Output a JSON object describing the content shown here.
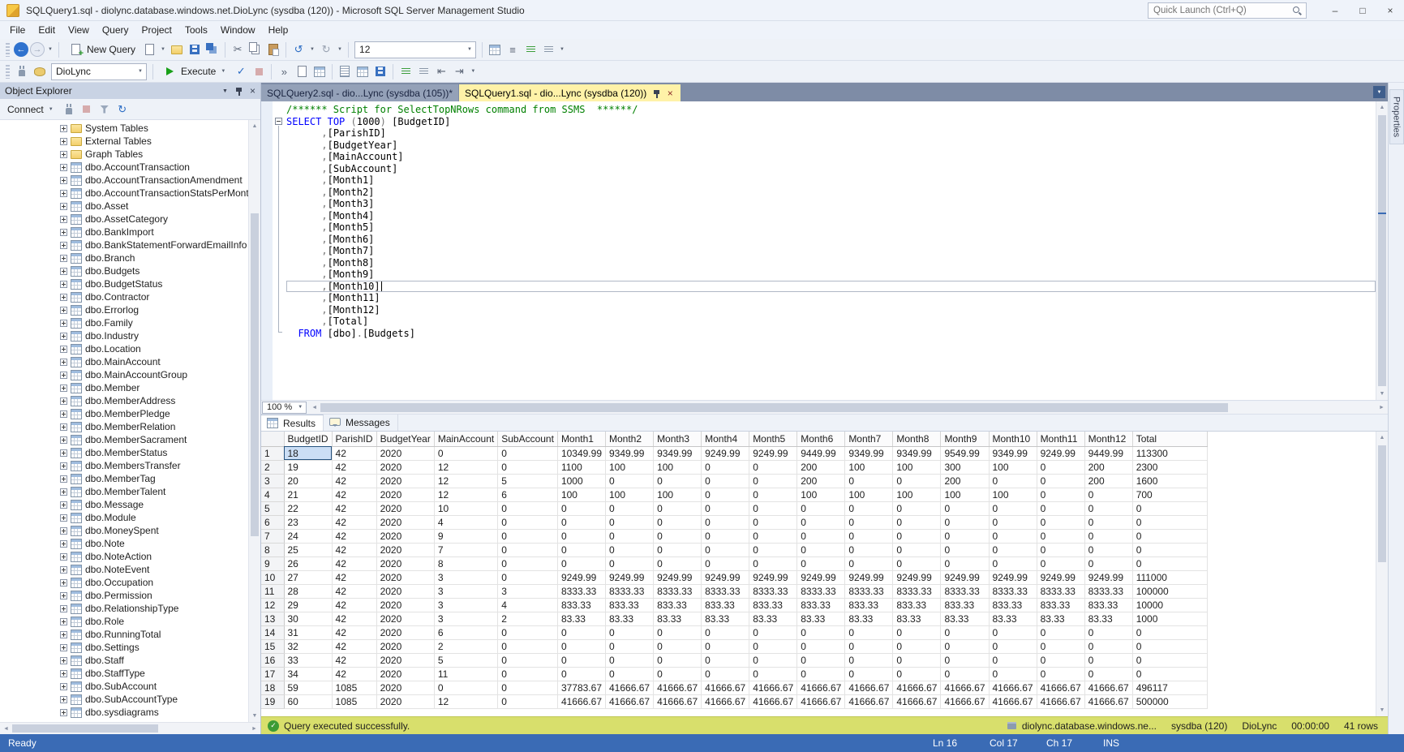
{
  "title_bar": {
    "title": "SQLQuery1.sql - diolync.database.windows.net.DioLync (sysdba (120)) - Microsoft SQL Server Management Studio",
    "quick_launch": "Quick Launch (Ctrl+Q)"
  },
  "menu": {
    "items": [
      "File",
      "Edit",
      "View",
      "Query",
      "Project",
      "Tools",
      "Window",
      "Help"
    ]
  },
  "toolbar_main": {
    "items": [
      {
        "kind": "grip"
      },
      {
        "kind": "navback",
        "name": "nav-back-icon",
        "glyph": "←"
      },
      {
        "kind": "navfwd",
        "name": "nav-forward-icon",
        "glyph": "→"
      },
      {
        "kind": "dd",
        "name": "nav-history-dropdown-icon",
        "glyph": "▼"
      },
      {
        "kind": "sep"
      },
      {
        "kind": "btn",
        "name": "new-query-button",
        "icon": "docplus",
        "label": "New Query"
      },
      {
        "kind": "doc",
        "name": "new-file-icon"
      },
      {
        "kind": "dd",
        "name": "new-file-dropdown-icon",
        "glyph": "▼"
      },
      {
        "kind": "folder",
        "name": "open-file-icon"
      },
      {
        "kind": "save",
        "name": "save-icon"
      },
      {
        "kind": "saveall",
        "name": "save-all-icon"
      },
      {
        "kind": "sep"
      },
      {
        "kind": "glyph",
        "name": "cut-icon",
        "glyph": "✂",
        "color": "#5A6475"
      },
      {
        "kind": "copy",
        "name": "copy-icon"
      },
      {
        "kind": "paste",
        "name": "paste-icon"
      },
      {
        "kind": "sep"
      },
      {
        "kind": "glyph",
        "name": "undo-icon",
        "glyph": "↺",
        "color": "#2B6CC4"
      },
      {
        "kind": "dd",
        "name": "undo-dropdown-icon",
        "glyph": "▼"
      },
      {
        "kind": "glyph",
        "name": "redo-icon",
        "glyph": "↻",
        "color": "#9AA3B2"
      },
      {
        "kind": "dd",
        "name": "redo-dropdown-icon",
        "glyph": "▼"
      },
      {
        "kind": "sep"
      },
      {
        "kind": "combo",
        "name": "font-size-combo",
        "value": "12",
        "width": 150
      },
      {
        "kind": "sep"
      },
      {
        "kind": "table",
        "name": "table-designer-icon"
      },
      {
        "kind": "glyph",
        "name": "properties-window-icon",
        "glyph": "≡",
        "color": "#5A6475"
      },
      {
        "kind": "comment",
        "name": "comment-icon"
      },
      {
        "kind": "comment2",
        "name": "uncomment-icon"
      },
      {
        "kind": "dd",
        "name": "toolbar-options-icon",
        "glyph": "▼"
      }
    ]
  },
  "toolbar_query": {
    "items": [
      {
        "kind": "grip"
      },
      {
        "kind": "plug",
        "name": "change-connection-icon"
      },
      {
        "kind": "db",
        "name": "available-databases-icon"
      },
      {
        "kind": "combo",
        "name": "database-combo",
        "value": "DioLync",
        "width": 118
      },
      {
        "kind": "sep"
      },
      {
        "kind": "btn",
        "name": "execute-button",
        "icon": "play",
        "label": "Execute",
        "dd": true
      },
      {
        "kind": "glyph",
        "name": "parse-icon",
        "glyph": "✓",
        "color": "#2B6CC4"
      },
      {
        "kind": "stop",
        "name": "cancel-query-icon",
        "disabled": true
      },
      {
        "kind": "sep"
      },
      {
        "kind": "glyph",
        "name": "sqlcmd-icon",
        "glyph": "»",
        "color": "#5A6475"
      },
      {
        "kind": "doc",
        "name": "display-estimated-plan-icon"
      },
      {
        "kind": "table",
        "name": "include-actual-plan-icon"
      },
      {
        "kind": "sep"
      },
      {
        "kind": "txt",
        "name": "results-to-text-icon"
      },
      {
        "kind": "grid3",
        "name": "results-to-grid-icon"
      },
      {
        "kind": "save",
        "name": "results-to-file-icon"
      },
      {
        "kind": "sep"
      },
      {
        "kind": "comment",
        "name": "comment-icon"
      },
      {
        "kind": "comment2",
        "name": "uncomment-icon"
      },
      {
        "kind": "glyph",
        "name": "decrease-indent-icon",
        "glyph": "⇤",
        "color": "#5A6475"
      },
      {
        "kind": "glyph",
        "name": "increase-indent-icon",
        "glyph": "⇥",
        "color": "#5A6475"
      },
      {
        "kind": "dd",
        "name": "toolbar-options-icon",
        "glyph": "▼"
      }
    ]
  },
  "object_explorer": {
    "title": "Object Explorer",
    "toolbar": [
      {
        "kind": "btn",
        "name": "connect-button",
        "label": "Connect",
        "dd": true
      },
      {
        "kind": "plug",
        "name": "disconnect-icon"
      },
      {
        "kind": "stop",
        "name": "stop-icon",
        "disabled": true
      },
      {
        "kind": "filter",
        "name": "filter-icon"
      },
      {
        "kind": "glyph",
        "name": "refresh-icon",
        "glyph": "↻",
        "color": "#2B6CC4"
      }
    ],
    "items": [
      {
        "type": "folder",
        "label": "System Tables"
      },
      {
        "type": "folder",
        "label": "External Tables"
      },
      {
        "type": "folder",
        "label": "Graph Tables"
      },
      {
        "type": "table",
        "label": "dbo.AccountTransaction"
      },
      {
        "type": "table",
        "label": "dbo.AccountTransactionAmendment"
      },
      {
        "type": "table",
        "label": "dbo.AccountTransactionStatsPerMonth"
      },
      {
        "type": "table",
        "label": "dbo.Asset"
      },
      {
        "type": "table",
        "label": "dbo.AssetCategory"
      },
      {
        "type": "table",
        "label": "dbo.BankImport"
      },
      {
        "type": "table",
        "label": "dbo.BankStatementForwardEmailInfo"
      },
      {
        "type": "table",
        "label": "dbo.Branch"
      },
      {
        "type": "table",
        "label": "dbo.Budgets"
      },
      {
        "type": "table",
        "label": "dbo.BudgetStatus"
      },
      {
        "type": "table",
        "label": "dbo.Contractor"
      },
      {
        "type": "table",
        "label": "dbo.Errorlog"
      },
      {
        "type": "table",
        "label": "dbo.Family"
      },
      {
        "type": "table",
        "label": "dbo.Industry"
      },
      {
        "type": "table",
        "label": "dbo.Location"
      },
      {
        "type": "table",
        "label": "dbo.MainAccount"
      },
      {
        "type": "table",
        "label": "dbo.MainAccountGroup"
      },
      {
        "type": "table",
        "label": "dbo.Member"
      },
      {
        "type": "table",
        "label": "dbo.MemberAddress"
      },
      {
        "type": "table",
        "label": "dbo.MemberPledge"
      },
      {
        "type": "table",
        "label": "dbo.MemberRelation"
      },
      {
        "type": "table",
        "label": "dbo.MemberSacrament"
      },
      {
        "type": "table",
        "label": "dbo.MemberStatus"
      },
      {
        "type": "table",
        "label": "dbo.MembersTransfer"
      },
      {
        "type": "table",
        "label": "dbo.MemberTag"
      },
      {
        "type": "table",
        "label": "dbo.MemberTalent"
      },
      {
        "type": "table",
        "label": "dbo.Message"
      },
      {
        "type": "table",
        "label": "dbo.Module"
      },
      {
        "type": "table",
        "label": "dbo.MoneySpent"
      },
      {
        "type": "table",
        "label": "dbo.Note"
      },
      {
        "type": "table",
        "label": "dbo.NoteAction"
      },
      {
        "type": "table",
        "label": "dbo.NoteEvent"
      },
      {
        "type": "table",
        "label": "dbo.Occupation"
      },
      {
        "type": "table",
        "label": "dbo.Permission"
      },
      {
        "type": "table",
        "label": "dbo.RelationshipType"
      },
      {
        "type": "table",
        "label": "dbo.Role"
      },
      {
        "type": "table",
        "label": "dbo.RunningTotal"
      },
      {
        "type": "table",
        "label": "dbo.Settings"
      },
      {
        "type": "table",
        "label": "dbo.Staff"
      },
      {
        "type": "table",
        "label": "dbo.StaffType"
      },
      {
        "type": "table",
        "label": "dbo.SubAccount"
      },
      {
        "type": "table",
        "label": "dbo.SubAccountType"
      },
      {
        "type": "table",
        "label": "dbo.sysdiagrams"
      }
    ]
  },
  "editor": {
    "tabs": [
      {
        "label": "SQLQuery2.sql - dio...Lync (sysdba (105))*"
      },
      {
        "label": "SQLQuery1.sql - dio...Lync (sysdba (120))"
      }
    ],
    "zoom": "100 %",
    "active_line": 15,
    "code_lines": [
      [
        [
          "/****** Script for SelectTopNRows command from SSMS  ******/",
          "c"
        ]
      ],
      [
        [
          "SELECT",
          "k"
        ],
        [
          " ",
          "t"
        ],
        [
          "TOP",
          "k"
        ],
        [
          " ",
          "t"
        ],
        [
          "(",
          "o"
        ],
        [
          "1000",
          "n"
        ],
        [
          ")",
          "o"
        ],
        [
          " [BudgetID]",
          "t"
        ]
      ],
      [
        [
          "      ",
          "t"
        ],
        [
          ",",
          "o"
        ],
        [
          "[ParishID]",
          "t"
        ]
      ],
      [
        [
          "      ",
          "t"
        ],
        [
          ",",
          "o"
        ],
        [
          "[BudgetYear]",
          "t"
        ]
      ],
      [
        [
          "      ",
          "t"
        ],
        [
          ",",
          "o"
        ],
        [
          "[MainAccount]",
          "t"
        ]
      ],
      [
        [
          "      ",
          "t"
        ],
        [
          ",",
          "o"
        ],
        [
          "[SubAccount]",
          "t"
        ]
      ],
      [
        [
          "      ",
          "t"
        ],
        [
          ",",
          "o"
        ],
        [
          "[Month1]",
          "t"
        ]
      ],
      [
        [
          "      ",
          "t"
        ],
        [
          ",",
          "o"
        ],
        [
          "[Month2]",
          "t"
        ]
      ],
      [
        [
          "      ",
          "t"
        ],
        [
          ",",
          "o"
        ],
        [
          "[Month3]",
          "t"
        ]
      ],
      [
        [
          "      ",
          "t"
        ],
        [
          ",",
          "o"
        ],
        [
          "[Month4]",
          "t"
        ]
      ],
      [
        [
          "      ",
          "t"
        ],
        [
          ",",
          "o"
        ],
        [
          "[Month5]",
          "t"
        ]
      ],
      [
        [
          "      ",
          "t"
        ],
        [
          ",",
          "o"
        ],
        [
          "[Month6]",
          "t"
        ]
      ],
      [
        [
          "      ",
          "t"
        ],
        [
          ",",
          "o"
        ],
        [
          "[Month7]",
          "t"
        ]
      ],
      [
        [
          "      ",
          "t"
        ],
        [
          ",",
          "o"
        ],
        [
          "[Month8]",
          "t"
        ]
      ],
      [
        [
          "      ",
          "t"
        ],
        [
          ",",
          "o"
        ],
        [
          "[Month9]",
          "t"
        ]
      ],
      [
        [
          "      ",
          "t"
        ],
        [
          ",",
          "o"
        ],
        [
          "[Month10]",
          "t"
        ]
      ],
      [
        [
          "      ",
          "t"
        ],
        [
          ",",
          "o"
        ],
        [
          "[Month11]",
          "t"
        ]
      ],
      [
        [
          "      ",
          "t"
        ],
        [
          ",",
          "o"
        ],
        [
          "[Month12]",
          "t"
        ]
      ],
      [
        [
          "      ",
          "t"
        ],
        [
          ",",
          "o"
        ],
        [
          "[Total]",
          "t"
        ]
      ],
      [
        [
          "  ",
          "t"
        ],
        [
          "FROM",
          "k"
        ],
        [
          " [dbo]",
          "t"
        ],
        [
          ".",
          "o"
        ],
        [
          "[Budgets]",
          "t"
        ]
      ]
    ]
  },
  "results": {
    "tabs": [
      "Results",
      "Messages"
    ],
    "columns": [
      "BudgetID",
      "ParishID",
      "BudgetYear",
      "MainAccount",
      "SubAccount",
      "Month1",
      "Month2",
      "Month3",
      "Month4",
      "Month5",
      "Month6",
      "Month7",
      "Month8",
      "Month9",
      "Month10",
      "Month11",
      "Month12",
      "Total"
    ],
    "selected_cell": {
      "row": 0,
      "col": 0
    },
    "rows": [
      [
        "18",
        "42",
        "2020",
        "0",
        "0",
        "10349.99",
        "9349.99",
        "9349.99",
        "9249.99",
        "9249.99",
        "9449.99",
        "9349.99",
        "9349.99",
        "9549.99",
        "9349.99",
        "9249.99",
        "9449.99",
        "113300"
      ],
      [
        "19",
        "42",
        "2020",
        "12",
        "0",
        "1100",
        "100",
        "100",
        "0",
        "0",
        "200",
        "100",
        "100",
        "300",
        "100",
        "0",
        "200",
        "2300"
      ],
      [
        "20",
        "42",
        "2020",
        "12",
        "5",
        "1000",
        "0",
        "0",
        "0",
        "0",
        "200",
        "0",
        "0",
        "200",
        "0",
        "0",
        "200",
        "1600"
      ],
      [
        "21",
        "42",
        "2020",
        "12",
        "6",
        "100",
        "100",
        "100",
        "0",
        "0",
        "100",
        "100",
        "100",
        "100",
        "100",
        "0",
        "0",
        "700"
      ],
      [
        "22",
        "42",
        "2020",
        "10",
        "0",
        "0",
        "0",
        "0",
        "0",
        "0",
        "0",
        "0",
        "0",
        "0",
        "0",
        "0",
        "0",
        "0"
      ],
      [
        "23",
        "42",
        "2020",
        "4",
        "0",
        "0",
        "0",
        "0",
        "0",
        "0",
        "0",
        "0",
        "0",
        "0",
        "0",
        "0",
        "0",
        "0"
      ],
      [
        "24",
        "42",
        "2020",
        "9",
        "0",
        "0",
        "0",
        "0",
        "0",
        "0",
        "0",
        "0",
        "0",
        "0",
        "0",
        "0",
        "0",
        "0"
      ],
      [
        "25",
        "42",
        "2020",
        "7",
        "0",
        "0",
        "0",
        "0",
        "0",
        "0",
        "0",
        "0",
        "0",
        "0",
        "0",
        "0",
        "0",
        "0"
      ],
      [
        "26",
        "42",
        "2020",
        "8",
        "0",
        "0",
        "0",
        "0",
        "0",
        "0",
        "0",
        "0",
        "0",
        "0",
        "0",
        "0",
        "0",
        "0"
      ],
      [
        "27",
        "42",
        "2020",
        "3",
        "0",
        "9249.99",
        "9249.99",
        "9249.99",
        "9249.99",
        "9249.99",
        "9249.99",
        "9249.99",
        "9249.99",
        "9249.99",
        "9249.99",
        "9249.99",
        "9249.99",
        "111000"
      ],
      [
        "28",
        "42",
        "2020",
        "3",
        "3",
        "8333.33",
        "8333.33",
        "8333.33",
        "8333.33",
        "8333.33",
        "8333.33",
        "8333.33",
        "8333.33",
        "8333.33",
        "8333.33",
        "8333.33",
        "8333.33",
        "100000"
      ],
      [
        "29",
        "42",
        "2020",
        "3",
        "4",
        "833.33",
        "833.33",
        "833.33",
        "833.33",
        "833.33",
        "833.33",
        "833.33",
        "833.33",
        "833.33",
        "833.33",
        "833.33",
        "833.33",
        "10000"
      ],
      [
        "30",
        "42",
        "2020",
        "3",
        "2",
        "83.33",
        "83.33",
        "83.33",
        "83.33",
        "83.33",
        "83.33",
        "83.33",
        "83.33",
        "83.33",
        "83.33",
        "83.33",
        "83.33",
        "1000"
      ],
      [
        "31",
        "42",
        "2020",
        "6",
        "0",
        "0",
        "0",
        "0",
        "0",
        "0",
        "0",
        "0",
        "0",
        "0",
        "0",
        "0",
        "0",
        "0"
      ],
      [
        "32",
        "42",
        "2020",
        "2",
        "0",
        "0",
        "0",
        "0",
        "0",
        "0",
        "0",
        "0",
        "0",
        "0",
        "0",
        "0",
        "0",
        "0"
      ],
      [
        "33",
        "42",
        "2020",
        "5",
        "0",
        "0",
        "0",
        "0",
        "0",
        "0",
        "0",
        "0",
        "0",
        "0",
        "0",
        "0",
        "0",
        "0"
      ],
      [
        "34",
        "42",
        "2020",
        "11",
        "0",
        "0",
        "0",
        "0",
        "0",
        "0",
        "0",
        "0",
        "0",
        "0",
        "0",
        "0",
        "0",
        "0"
      ],
      [
        "59",
        "1085",
        "2020",
        "0",
        "0",
        "37783.67",
        "41666.67",
        "41666.67",
        "41666.67",
        "41666.67",
        "41666.67",
        "41666.67",
        "41666.67",
        "41666.67",
        "41666.67",
        "41666.67",
        "41666.67",
        "496117"
      ],
      [
        "60",
        "1085",
        "2020",
        "12",
        "0",
        "41666.67",
        "41666.67",
        "41666.67",
        "41666.67",
        "41666.67",
        "41666.67",
        "41666.67",
        "41666.67",
        "41666.67",
        "41666.67",
        "41666.67",
        "41666.67",
        "500000"
      ]
    ]
  },
  "exec_status": {
    "message": "Query executed successfully.",
    "server": "diolync.database.windows.ne...",
    "login": "sysdba (120)",
    "database": "DioLync",
    "duration": "00:00:00",
    "rows": "41 rows"
  },
  "right_strip": {
    "properties_label": "Properties"
  },
  "statusbar": {
    "state": "Ready",
    "ln": "Ln 16",
    "col": "Col 17",
    "ch": "Ch 17",
    "mode": "INS"
  }
}
